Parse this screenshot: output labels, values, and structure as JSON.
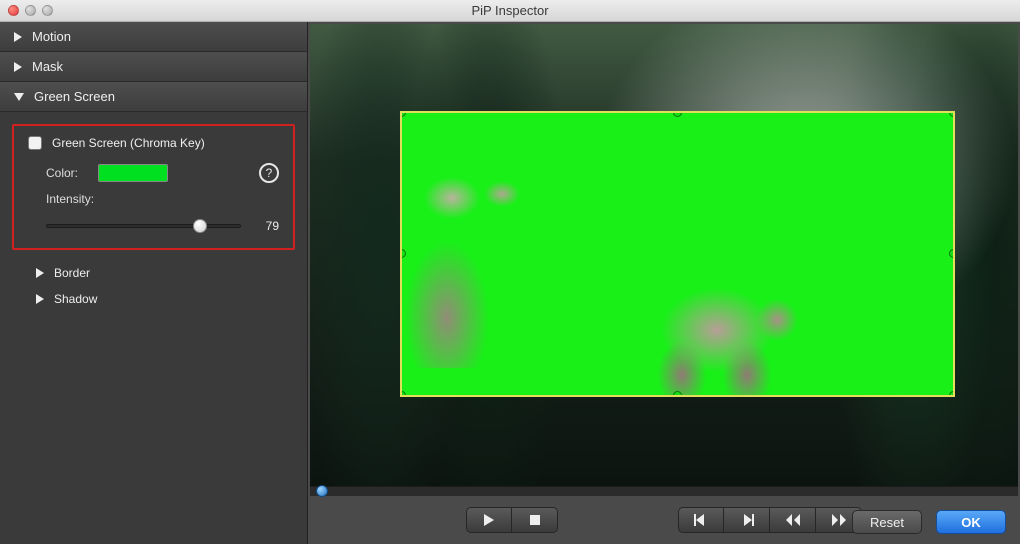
{
  "window": {
    "title": "PiP Inspector"
  },
  "sidebar": {
    "items": [
      {
        "label": "Motion",
        "expanded": false
      },
      {
        "label": "Mask",
        "expanded": false
      },
      {
        "label": "Green Screen",
        "expanded": true
      }
    ]
  },
  "greenScreen": {
    "checkboxLabel": "Green Screen (Chroma Key)",
    "checked": false,
    "colorLabel": "Color:",
    "colorValue": "#00e020",
    "intensityLabel": "Intensity:",
    "intensityValue": "79",
    "subItems": [
      {
        "label": "Border"
      },
      {
        "label": "Shadow"
      }
    ]
  },
  "footer": {
    "reset": "Reset",
    "ok": "OK"
  },
  "transport": {
    "play": "play-icon",
    "stop": "stop-icon",
    "stepBack": "step-back-icon",
    "stepFwd": "step-forward-icon",
    "goStart": "go-start-icon",
    "goEnd": "go-end-icon"
  }
}
